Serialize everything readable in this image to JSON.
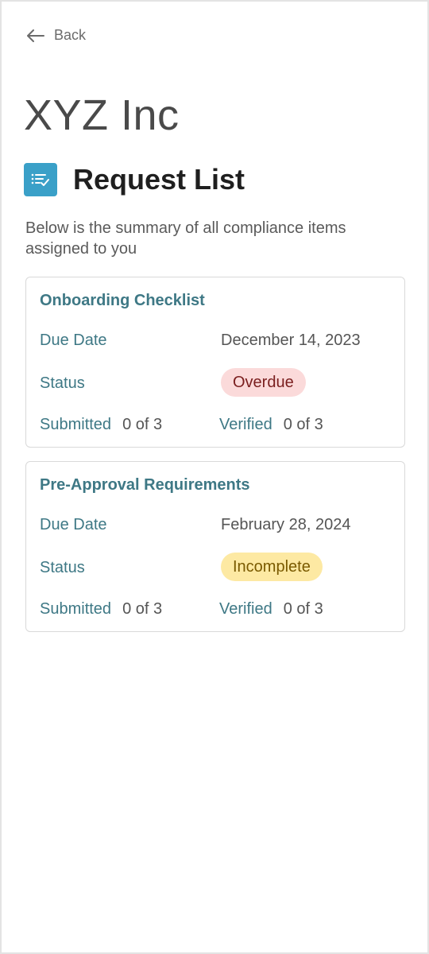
{
  "nav": {
    "back_label": "Back"
  },
  "company": "XYZ Inc",
  "title": "Request List",
  "description": "Below is the summary of all compliance items assigned to you",
  "colors": {
    "accent": "#3aa0c8",
    "label": "#3e7885",
    "overdue_bg": "#fbdada",
    "incomplete_bg": "#fde9a3"
  },
  "requests": [
    {
      "name": "Onboarding Checklist",
      "due_label": "Due Date",
      "due_date": "December 14, 2023",
      "status_label": "Status",
      "status": "Overdue",
      "submitted_label": "Submitted",
      "submitted": "0 of 3",
      "verified_label": "Verified",
      "verified": "0 of 3"
    },
    {
      "name": "Pre-Approval Requirements",
      "due_label": "Due Date",
      "due_date": "February 28, 2024",
      "status_label": "Status",
      "status": "Incomplete",
      "submitted_label": "Submitted",
      "submitted": "0 of 3",
      "verified_label": "Verified",
      "verified": "0 of 3"
    }
  ]
}
